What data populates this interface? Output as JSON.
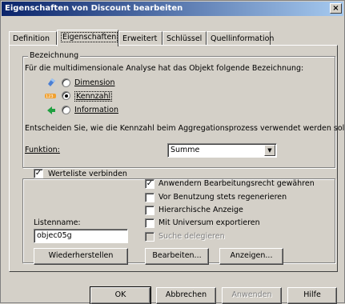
{
  "window": {
    "title": "Eigenschaften von Discount bearbeiten",
    "close": "×"
  },
  "tabs": [
    {
      "label": "Definition"
    },
    {
      "label": "Eigenschaften"
    },
    {
      "label": "Erweitert"
    },
    {
      "label": "Schlüssel"
    },
    {
      "label": "Quellinformation"
    }
  ],
  "bezeichnung": {
    "legend": "Bezeichnung",
    "description": "Für die multidimensionale Analyse hat das Objekt folgende Bezeichnung:",
    "options": [
      {
        "label": "Dimension",
        "selected": false,
        "icon": "dimension-icon"
      },
      {
        "label": "Kennzahl",
        "selected": true,
        "icon": "measure-icon"
      },
      {
        "label": "Information",
        "selected": false,
        "icon": "information-icon"
      }
    ],
    "aggregation_text": "Entscheiden Sie, wie die Kennzahl beim Aggregationsprozess verwendet werden soll:",
    "function_label": "Funktion:",
    "function_value": "Summe"
  },
  "werteliste": {
    "legend": "Werteliste verbinden",
    "legend_checked": true,
    "checkboxes": [
      {
        "label": "Anwendern Bearbeitungsrecht gewähren",
        "checked": true,
        "enabled": true
      },
      {
        "label": "Vor Benutzung stets regenerieren",
        "checked": false,
        "enabled": true
      },
      {
        "label": "Hierarchische Anzeige",
        "checked": false,
        "enabled": true
      },
      {
        "label": "Mit Universum exportieren",
        "checked": false,
        "enabled": true
      },
      {
        "label": "Suche delegieren",
        "checked": false,
        "enabled": false
      }
    ],
    "listname_label": "Listenname:",
    "listname_value": "objec05g",
    "restore_button": "Wiederherstellen",
    "edit_button": "Bearbeiten...",
    "show_button": "Anzeigen..."
  },
  "footer": {
    "ok": "OK",
    "cancel": "Abbrechen",
    "apply": "Anwenden",
    "help": "Hilfe"
  },
  "colors": {
    "title_start": "#0a246a",
    "title_end": "#a6caf0",
    "dialog_bg": "#d4d0c8"
  }
}
